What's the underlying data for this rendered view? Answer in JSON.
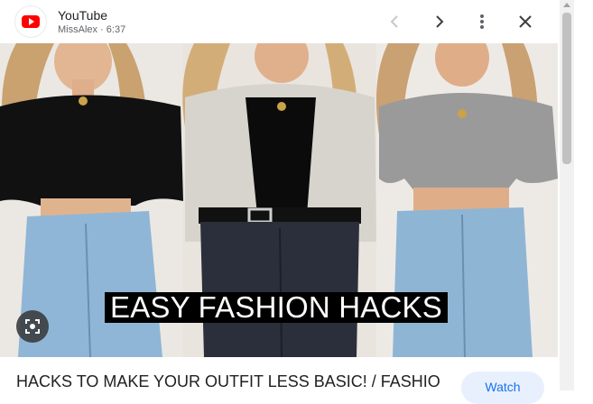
{
  "header": {
    "source_name": "YouTube",
    "meta": "MissAlex · 6:37"
  },
  "icons": {
    "logo": "youtube-logo-icon",
    "prev": "chevron-left-icon",
    "next": "chevron-right-icon",
    "more": "more-vert-icon",
    "close": "close-icon",
    "lens": "google-lens-icon"
  },
  "video": {
    "overlay_text": "EASY FASHION HACKS",
    "title": "HACKS TO MAKE YOUR OUTFIT LESS BASIC! / FASHION",
    "watch_label": "Watch"
  },
  "colors": {
    "brand_red": "#ff0000",
    "accent_blue": "#1a73e8",
    "watch_bg": "#e8f0fe"
  }
}
